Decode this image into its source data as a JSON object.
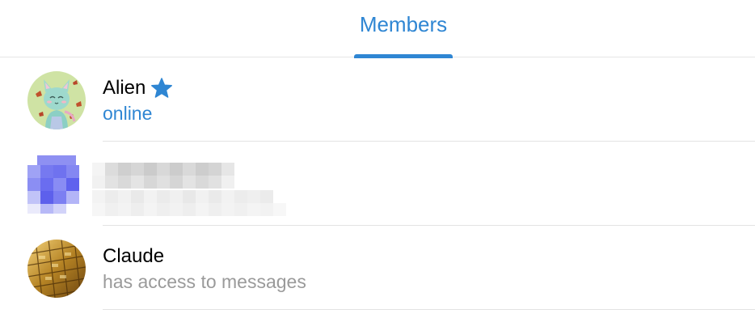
{
  "tabs": [
    {
      "label": "Members",
      "active": true
    }
  ],
  "members": [
    {
      "name": "Alien",
      "status": "online",
      "status_type": "online",
      "badge_icon": "star-icon",
      "avatar_icon": "cartoon-cat-avatar"
    },
    {
      "name": "",
      "status": "",
      "status_type": "redacted",
      "avatar_icon": "pixelated-avatar"
    },
    {
      "name": "Claude",
      "status": "has access to messages",
      "status_type": "muted",
      "avatar_icon": "gold-bars-avatar"
    }
  ],
  "colors": {
    "accent": "#2f86d3",
    "muted_text": "#9a9a9a",
    "divider": "#e3e3e3"
  }
}
